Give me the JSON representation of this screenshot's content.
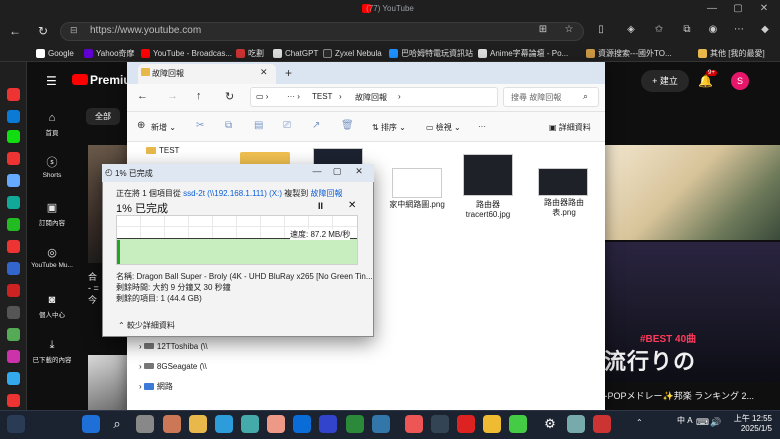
{
  "browser": {
    "window_title": "(77) YouTube",
    "url": "https://www.youtube.com",
    "bookmarks": [
      "Google",
      "Yahoo奇摩",
      "YouTube - Broadcas...",
      "吃劃",
      "ChatGPT",
      "Zyxel Nebula",
      "巴哈姆特電玩資訊站",
      "Anime字幕論壇 - Po...",
      "資源搜索---國外TO...",
      "其他 [我的最愛]"
    ]
  },
  "youtube": {
    "logo_text": "Premium",
    "chip": "全部",
    "create_label": "建立",
    "notif_count": "9+",
    "avatar_letter": "S",
    "nav": [
      {
        "label": "首頁",
        "icon": "home-icon"
      },
      {
        "label": "Shorts",
        "icon": "shorts-icon"
      },
      {
        "label": "訂閱內容",
        "icon": "subscriptions-icon"
      },
      {
        "label": "YouTube Mu...",
        "icon": "music-icon"
      },
      {
        "label": "個人中心",
        "icon": "person-icon"
      },
      {
        "label": "已下載的內容",
        "icon": "download-icon"
      }
    ],
    "video_title_right": "J-POPメドレー✨邦楽 ランキング 2...",
    "thumb_text_small": "#BEST 40曲",
    "thumb_text_big": "流行りの",
    "left_caption_1": "合",
    "left_caption_2": "- =",
    "left_caption_3": "今"
  },
  "explorer": {
    "tab_title": "故障回報",
    "breadcrumb": [
      "TEST",
      "故障回報"
    ],
    "search_placeholder": "搜尋 故障回報",
    "commands": {
      "new": "新增",
      "sort": "排序",
      "view": "檢視",
      "details": "詳細資料"
    },
    "tree": [
      "TEST",
      "12TToshiba (\\\\",
      "8GSeagate (\\\\",
      "網路"
    ],
    "files": [
      {
        "name": "家中網路圖.png"
      },
      {
        "name": "路由器\ntracert60.jpg"
      },
      {
        "name": "路由器路由表.png"
      }
    ]
  },
  "copy_dialog": {
    "title": "1% 已完成",
    "line1_prefix": "正在將 1 個項目從",
    "source": "ssd-2t (\\\\192.168.1.111) (X:)",
    "line1_mid": "複製到",
    "dest": "故障回報",
    "percent_text": "1% 已完成",
    "progress_percent": 1,
    "speed": "速度: 87.2 MB/秒",
    "name_label": "名稱: Dragon Ball Super - Broly (4K - UHD BluRay x265 [No Green Tin...",
    "time_left": "剩餘時間: 大約 9 分鐘又 30 秒鐘",
    "items_left": "剩餘的項目: 1 (44.4 GB)",
    "less_details": "較少詳細資料",
    "pause_symbol": "II",
    "close_symbol": "✕"
  },
  "taskbar": {
    "time": "上午 12:55",
    "date": "2025/1/5",
    "ime": "中",
    "lang": "A"
  }
}
